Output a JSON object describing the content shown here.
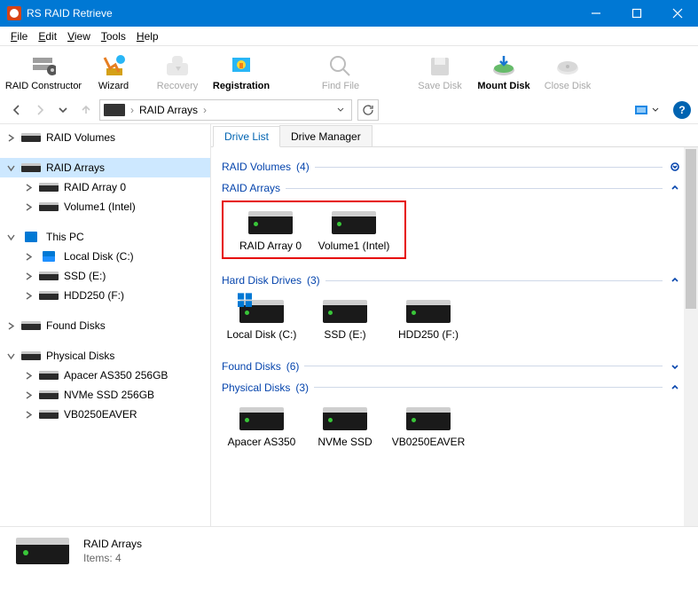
{
  "window": {
    "title": "RS RAID Retrieve"
  },
  "menu": {
    "file": "File",
    "edit": "Edit",
    "view": "View",
    "tools": "Tools",
    "help": "Help"
  },
  "toolbar": {
    "raid_constructor": "RAID Constructor",
    "wizard": "Wizard",
    "recovery": "Recovery",
    "registration": "Registration",
    "find_file": "Find File",
    "save_disk": "Save Disk",
    "mount_disk": "Mount Disk",
    "close_disk": "Close Disk"
  },
  "breadcrumb": {
    "root": "RAID Arrays"
  },
  "tree": {
    "raid_volumes": "RAID Volumes",
    "raid_arrays": "RAID Arrays",
    "raid_array_0": "RAID Array 0",
    "volume1_intel": "Volume1 (Intel)",
    "this_pc": "This PC",
    "local_disk_c": "Local Disk (C:)",
    "ssd_e": "SSD (E:)",
    "hdd250_f": "HDD250 (F:)",
    "found_disks": "Found Disks",
    "physical_disks": "Physical Disks",
    "apacer": "Apacer AS350 256GB",
    "nvme": "NVMe SSD 256GB",
    "vb0250": "VB0250EAVER"
  },
  "tabs": {
    "drive_list": "Drive List",
    "drive_manager": "Drive Manager"
  },
  "sections": {
    "raid_volumes": {
      "label": "RAID Volumes",
      "count": "(4)"
    },
    "raid_arrays": {
      "label": "RAID Arrays"
    },
    "hard_disk_drives": {
      "label": "Hard Disk Drives",
      "count": "(3)"
    },
    "found_disks": {
      "label": "Found Disks",
      "count": "(6)"
    },
    "physical_disks": {
      "label": "Physical Disks",
      "count": "(3)"
    }
  },
  "items": {
    "raid_array_0": "RAID Array 0",
    "volume1_intel": "Volume1 (Intel)",
    "local_disk_c": "Local Disk (C:)",
    "ssd_e": "SSD (E:)",
    "hdd250_f": "HDD250 (F:)",
    "apacer": "Apacer AS350",
    "nvme": "NVMe SSD",
    "vb0250": "VB0250EAVER"
  },
  "status": {
    "title": "RAID Arrays",
    "items": "Items: 4"
  }
}
